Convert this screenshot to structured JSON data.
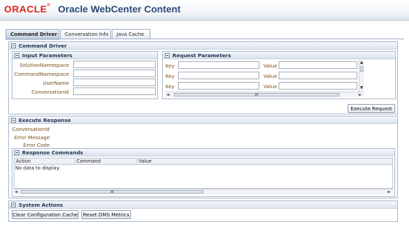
{
  "header": {
    "logo": "ORACLE",
    "logo_mark": "®",
    "title": "Oracle WebCenter Content"
  },
  "tabs": [
    {
      "label": "Command Driver",
      "active": true
    },
    {
      "label": "Conversation Info",
      "active": false
    },
    {
      "label": "Java Cache",
      "active": false
    }
  ],
  "command_driver": {
    "title": "Command Driver",
    "input_parameters": {
      "title": "Input Parameters",
      "fields": [
        {
          "label": "SolutionNamespace",
          "value": ""
        },
        {
          "label": "CommandNamespace",
          "value": ""
        },
        {
          "label": "UserName",
          "value": ""
        },
        {
          "label": "ConversationId",
          "value": ""
        }
      ]
    },
    "request_parameters": {
      "title": "Request Parameters",
      "rows": [
        {
          "key_label": "Key",
          "key_value": "",
          "value_label": "Value",
          "value_value": ""
        },
        {
          "key_label": "Key",
          "key_value": "",
          "value_label": "Value",
          "value_value": ""
        },
        {
          "key_label": "Key",
          "key_value": "",
          "value_label": "Value",
          "value_value": ""
        }
      ],
      "hscroll_grip": "III"
    },
    "execute_button": "Execute Request"
  },
  "execute_response": {
    "title": "Execute Response",
    "fields": [
      {
        "label": "ConversationId"
      },
      {
        "label": "Error Message"
      },
      {
        "label": "Error Code"
      }
    ],
    "response_commands": {
      "title": "Response Commands",
      "columns": [
        "Action",
        "Command",
        "Value"
      ],
      "empty_text": "No data to display.",
      "hscroll_grip": "III"
    }
  },
  "system_actions": {
    "title": "System Actions",
    "buttons": [
      "Clear Configuration Cache",
      "Reset DMS Metrics"
    ]
  }
}
